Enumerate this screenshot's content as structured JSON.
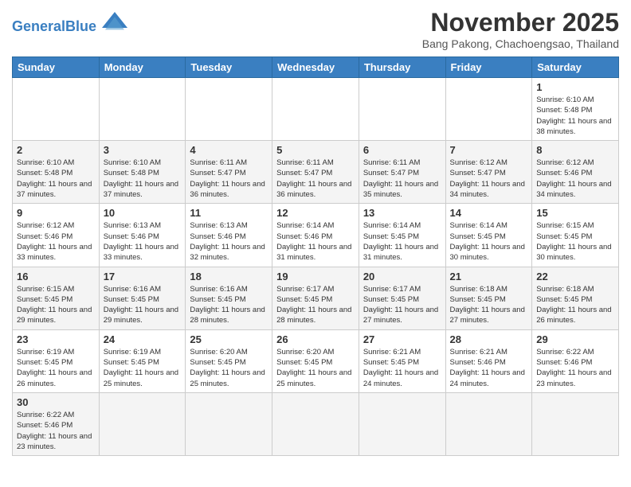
{
  "logo": {
    "text_general": "General",
    "text_blue": "Blue"
  },
  "title": "November 2025",
  "subtitle": "Bang Pakong, Chachoengsao, Thailand",
  "days_of_week": [
    "Sunday",
    "Monday",
    "Tuesday",
    "Wednesday",
    "Thursday",
    "Friday",
    "Saturday"
  ],
  "weeks": [
    [
      {
        "day": "",
        "info": ""
      },
      {
        "day": "",
        "info": ""
      },
      {
        "day": "",
        "info": ""
      },
      {
        "day": "",
        "info": ""
      },
      {
        "day": "",
        "info": ""
      },
      {
        "day": "",
        "info": ""
      },
      {
        "day": "1",
        "info": "Sunrise: 6:10 AM\nSunset: 5:48 PM\nDaylight: 11 hours and 38 minutes."
      }
    ],
    [
      {
        "day": "2",
        "info": "Sunrise: 6:10 AM\nSunset: 5:48 PM\nDaylight: 11 hours and 37 minutes."
      },
      {
        "day": "3",
        "info": "Sunrise: 6:10 AM\nSunset: 5:48 PM\nDaylight: 11 hours and 37 minutes."
      },
      {
        "day": "4",
        "info": "Sunrise: 6:11 AM\nSunset: 5:47 PM\nDaylight: 11 hours and 36 minutes."
      },
      {
        "day": "5",
        "info": "Sunrise: 6:11 AM\nSunset: 5:47 PM\nDaylight: 11 hours and 36 minutes."
      },
      {
        "day": "6",
        "info": "Sunrise: 6:11 AM\nSunset: 5:47 PM\nDaylight: 11 hours and 35 minutes."
      },
      {
        "day": "7",
        "info": "Sunrise: 6:12 AM\nSunset: 5:47 PM\nDaylight: 11 hours and 34 minutes."
      },
      {
        "day": "8",
        "info": "Sunrise: 6:12 AM\nSunset: 5:46 PM\nDaylight: 11 hours and 34 minutes."
      }
    ],
    [
      {
        "day": "9",
        "info": "Sunrise: 6:12 AM\nSunset: 5:46 PM\nDaylight: 11 hours and 33 minutes."
      },
      {
        "day": "10",
        "info": "Sunrise: 6:13 AM\nSunset: 5:46 PM\nDaylight: 11 hours and 33 minutes."
      },
      {
        "day": "11",
        "info": "Sunrise: 6:13 AM\nSunset: 5:46 PM\nDaylight: 11 hours and 32 minutes."
      },
      {
        "day": "12",
        "info": "Sunrise: 6:14 AM\nSunset: 5:46 PM\nDaylight: 11 hours and 31 minutes."
      },
      {
        "day": "13",
        "info": "Sunrise: 6:14 AM\nSunset: 5:45 PM\nDaylight: 11 hours and 31 minutes."
      },
      {
        "day": "14",
        "info": "Sunrise: 6:14 AM\nSunset: 5:45 PM\nDaylight: 11 hours and 30 minutes."
      },
      {
        "day": "15",
        "info": "Sunrise: 6:15 AM\nSunset: 5:45 PM\nDaylight: 11 hours and 30 minutes."
      }
    ],
    [
      {
        "day": "16",
        "info": "Sunrise: 6:15 AM\nSunset: 5:45 PM\nDaylight: 11 hours and 29 minutes."
      },
      {
        "day": "17",
        "info": "Sunrise: 6:16 AM\nSunset: 5:45 PM\nDaylight: 11 hours and 29 minutes."
      },
      {
        "day": "18",
        "info": "Sunrise: 6:16 AM\nSunset: 5:45 PM\nDaylight: 11 hours and 28 minutes."
      },
      {
        "day": "19",
        "info": "Sunrise: 6:17 AM\nSunset: 5:45 PM\nDaylight: 11 hours and 28 minutes."
      },
      {
        "day": "20",
        "info": "Sunrise: 6:17 AM\nSunset: 5:45 PM\nDaylight: 11 hours and 27 minutes."
      },
      {
        "day": "21",
        "info": "Sunrise: 6:18 AM\nSunset: 5:45 PM\nDaylight: 11 hours and 27 minutes."
      },
      {
        "day": "22",
        "info": "Sunrise: 6:18 AM\nSunset: 5:45 PM\nDaylight: 11 hours and 26 minutes."
      }
    ],
    [
      {
        "day": "23",
        "info": "Sunrise: 6:19 AM\nSunset: 5:45 PM\nDaylight: 11 hours and 26 minutes."
      },
      {
        "day": "24",
        "info": "Sunrise: 6:19 AM\nSunset: 5:45 PM\nDaylight: 11 hours and 25 minutes."
      },
      {
        "day": "25",
        "info": "Sunrise: 6:20 AM\nSunset: 5:45 PM\nDaylight: 11 hours and 25 minutes."
      },
      {
        "day": "26",
        "info": "Sunrise: 6:20 AM\nSunset: 5:45 PM\nDaylight: 11 hours and 25 minutes."
      },
      {
        "day": "27",
        "info": "Sunrise: 6:21 AM\nSunset: 5:45 PM\nDaylight: 11 hours and 24 minutes."
      },
      {
        "day": "28",
        "info": "Sunrise: 6:21 AM\nSunset: 5:46 PM\nDaylight: 11 hours and 24 minutes."
      },
      {
        "day": "29",
        "info": "Sunrise: 6:22 AM\nSunset: 5:46 PM\nDaylight: 11 hours and 23 minutes."
      }
    ],
    [
      {
        "day": "30",
        "info": "Sunrise: 6:22 AM\nSunset: 5:46 PM\nDaylight: 11 hours and 23 minutes."
      },
      {
        "day": "",
        "info": ""
      },
      {
        "day": "",
        "info": ""
      },
      {
        "day": "",
        "info": ""
      },
      {
        "day": "",
        "info": ""
      },
      {
        "day": "",
        "info": ""
      },
      {
        "day": "",
        "info": ""
      }
    ]
  ]
}
